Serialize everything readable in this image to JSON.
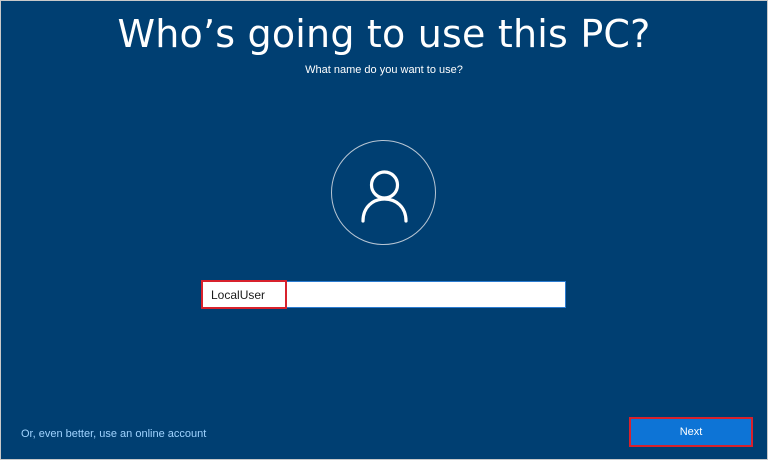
{
  "header": {
    "title": "Who’s going to use this PC?",
    "subtitle": "What name do you want to use?"
  },
  "avatar": {
    "icon": "user-icon"
  },
  "name_field": {
    "value": "LocalUser",
    "placeholder": ""
  },
  "footer": {
    "online_link": "Or, even better, use an online account",
    "next_label": "Next"
  },
  "colors": {
    "background": "#003f72",
    "accent": "#0d74d6",
    "link": "#9fd3ff",
    "highlight": "#d8212c"
  }
}
